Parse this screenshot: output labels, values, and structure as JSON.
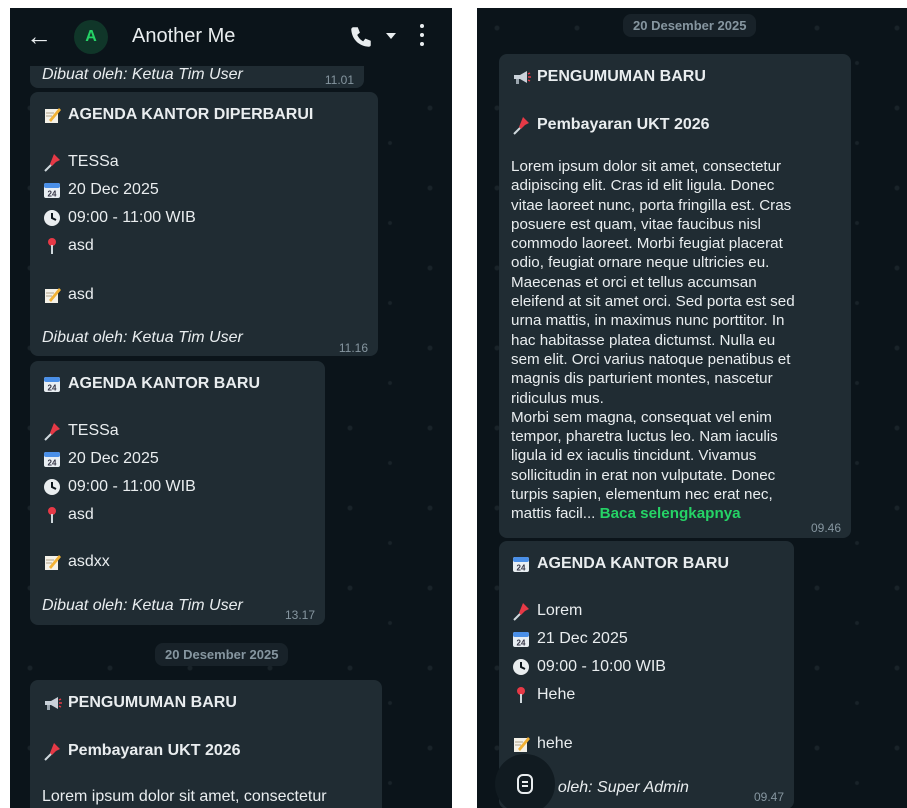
{
  "header": {
    "contact_name": "Another Me",
    "avatar_letter": "A"
  },
  "left": {
    "cut_creator": "Dibuat oleh: Ketua Tim User",
    "cut_time": "11.01",
    "msg1": {
      "title": "AGENDA KANTOR DIPERBARUI",
      "topic": "TESSa",
      "date": "20 Dec 2025",
      "time_range": "09:00 - 11:00 WIB",
      "location": "asd",
      "note": "asd",
      "creator": "Dibuat oleh: Ketua Tim User",
      "time": "11.16"
    },
    "msg2": {
      "title": "AGENDA KANTOR BARU",
      "topic": "TESSa",
      "date": "20 Dec 2025",
      "time_range": "09:00 - 11:00 WIB",
      "location": "asd",
      "note": "asdxx",
      "creator": "Dibuat oleh: Ketua Tim User",
      "time": "13.17"
    },
    "date_chip": "20 Desember 2025",
    "msg3": {
      "title": "PENGUMUMAN BARU",
      "subject": "Pembayaran UKT 2026",
      "body_start": "Lorem ipsum dolor sit amet, consectetur"
    }
  },
  "right": {
    "date_chip": "20 Desember 2025",
    "announcement": {
      "title": "PENGUMUMAN BARU",
      "subject": "Pembayaran UKT 2026",
      "body_lines": [
        "Lorem ipsum dolor sit amet, consectetur",
        "adipiscing elit. Cras id elit ligula. Donec",
        "vitae laoreet nunc, porta fringilla est. Cras",
        "posuere est quam, vitae faucibus nisl",
        "commodo laoreet. Morbi feugiat placerat",
        "odio, feugiat ornare neque ultricies eu.",
        "Maecenas et orci et tellus accumsan",
        "eleifend at sit amet orci. Sed porta est sed",
        "urna mattis, in maximus nunc porttitor. In",
        "hac habitasse platea dictumst. Nulla eu",
        "sem elit. Orci varius natoque penatibus et",
        "magnis dis parturient montes, nascetur",
        "ridiculus mus.",
        "Morbi sem magna, consequat vel enim",
        "tempor, pharetra luctus leo. Nam iaculis",
        "ligula id ex iaculis tincidunt. Vivamus",
        "sollicitudin in erat non vulputate. Donec",
        "turpis sapien, elementum nec erat nec,"
      ],
      "last_line": "mattis facil...",
      "read_more": "Baca selengkapnya",
      "time": "09.46"
    },
    "agenda": {
      "title": "AGENDA KANTOR BARU",
      "topic": "Lorem",
      "date": "21 Dec 2025",
      "time_range": "09:00 - 10:00 WIB",
      "location": "Hehe",
      "note": "hehe",
      "creator": "t oleh: Super Admin",
      "time": "09.47"
    }
  },
  "colors": {
    "background": "#0b141a",
    "bubble": "#202c33",
    "accent": "#25d366",
    "muted": "#8696a0"
  }
}
